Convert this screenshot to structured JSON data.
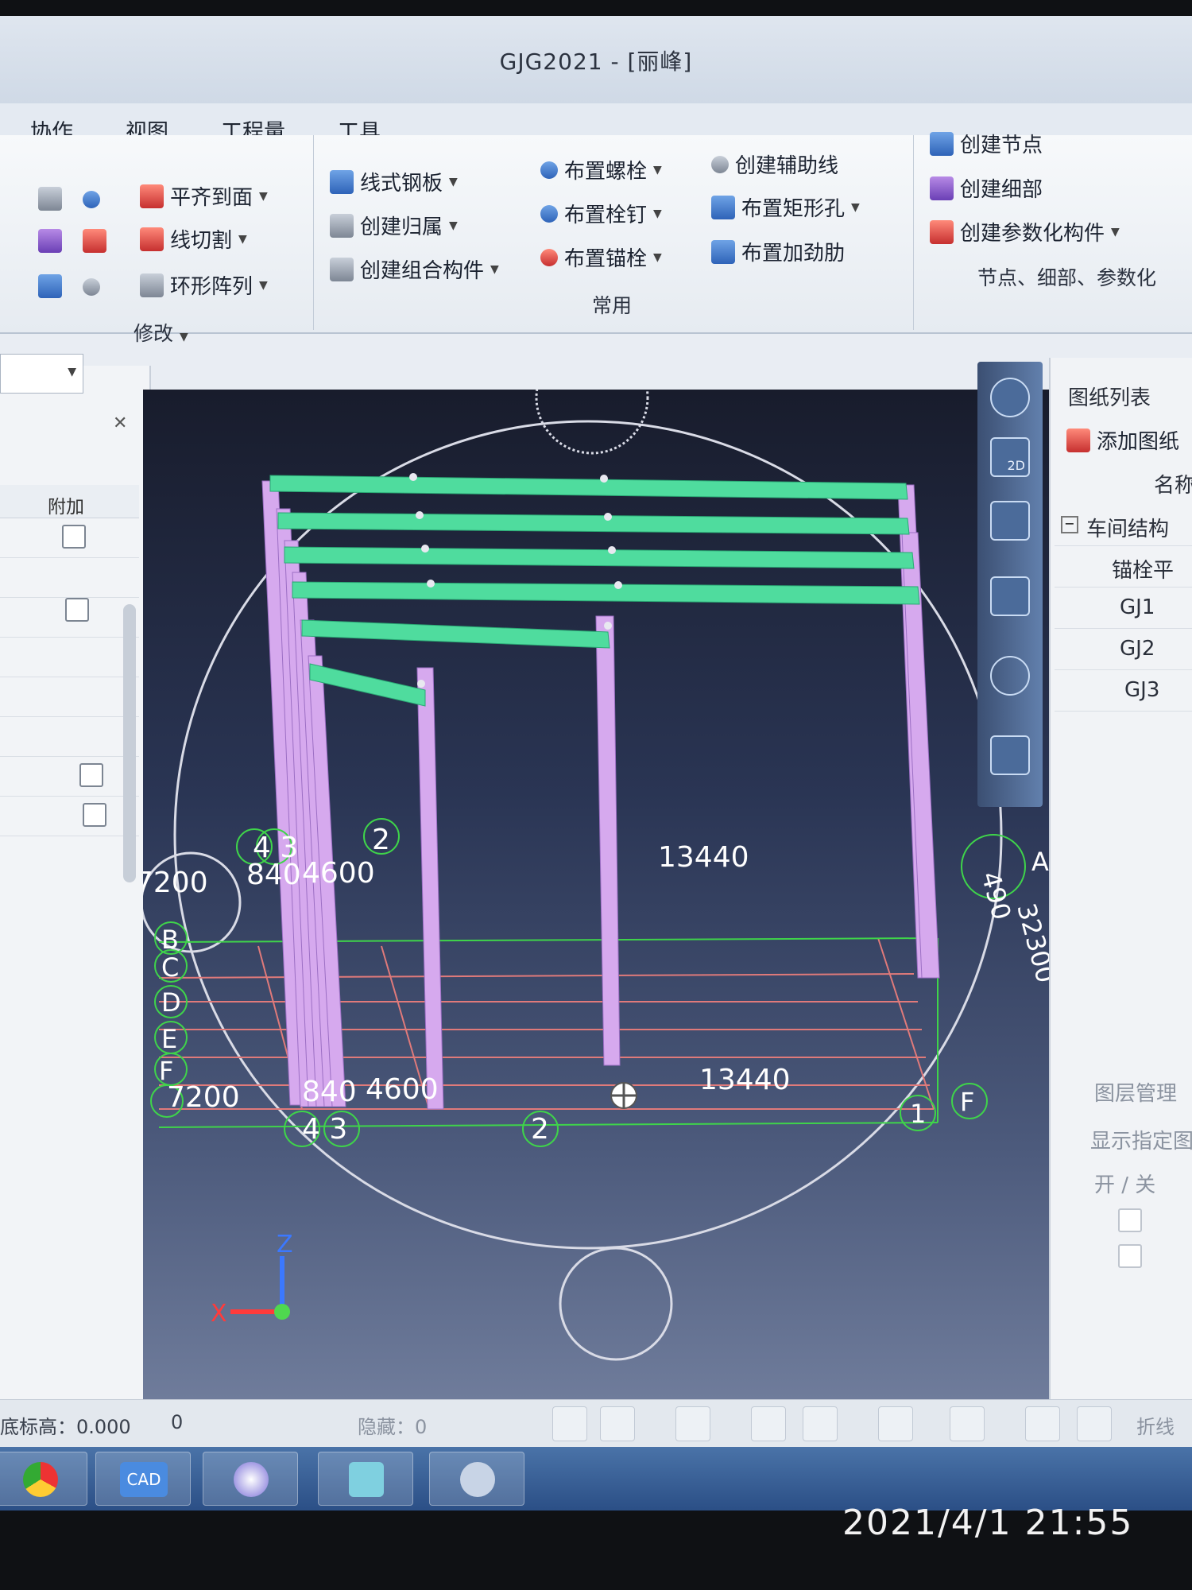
{
  "window": {
    "title": "GJG2021 - [丽峰]"
  },
  "menu_tabs": [
    "协作",
    "视图",
    "工程量",
    "工具"
  ],
  "ribbon": {
    "modify_group": {
      "items": [
        "平齐到面",
        "线切割",
        "环形阵列"
      ],
      "label": "修改"
    },
    "common_group": {
      "col1": [
        "线式钢板",
        "创建归属",
        "创建组合构件"
      ],
      "col2": [
        "布置螺栓",
        "布置栓钉",
        "布置锚栓"
      ],
      "col3": [
        "创建辅助线",
        "布置矩形孔",
        "布置加劲肋"
      ],
      "label": "常用"
    },
    "node_group": {
      "items": [
        "创建节点",
        "创建细部",
        "创建参数化构件"
      ],
      "label": "节点、细部、参数化"
    }
  },
  "left_panel": {
    "column_header": "附加"
  },
  "right_panel": {
    "title": "图纸列表",
    "add_button": "添加图纸",
    "column_name": "名称",
    "tree_root": "车间结构",
    "items": [
      "锚栓平",
      "GJ1",
      "GJ2",
      "GJ3"
    ],
    "layer_title": "图层管理",
    "layer_hint": "显示指定图",
    "layer_col": "开 / 关"
  },
  "viewport": {
    "axis_top_left": "4 3",
    "dim_top": [
      "7200",
      "840",
      "4600",
      "13440"
    ],
    "axis_2_top": "2",
    "right_dims": [
      "490",
      "32300"
    ],
    "right_axis_A": "A",
    "rows": [
      "B",
      "C",
      "D",
      "E",
      "F"
    ],
    "dim_bottom": [
      "7200",
      "840",
      "4600",
      "13440"
    ],
    "axis_bottom": [
      "4 3",
      "2",
      "1"
    ],
    "right_axis_F": "F",
    "axis_x": "X",
    "axis_z": "Z"
  },
  "status_bar": {
    "elevation": "底标高：0.000",
    "count": "0",
    "hidden": "隐藏：0",
    "polyline": "折线"
  },
  "taskbar": {
    "cad_label": "CAD"
  },
  "timestamp": "2021/4/1  21:55"
}
